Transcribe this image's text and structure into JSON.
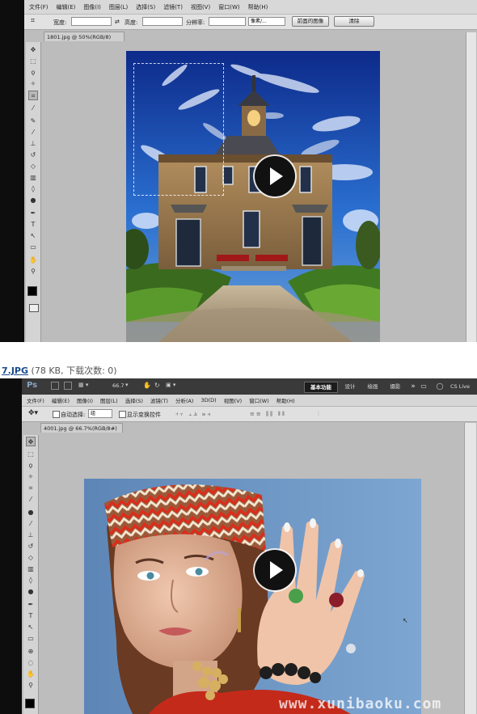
{
  "shot1": {
    "menu": [
      "文件(F)",
      "编辑(E)",
      "图像(I)",
      "图层(L)",
      "选择(S)",
      "滤镜(T)",
      "视图(V)",
      "窗口(W)",
      "帮助(H)"
    ],
    "options": {
      "width_label": "宽度:",
      "height_label": "高度:",
      "resolution_label": "分辨率:",
      "unit_value": "像素/...",
      "front_image_button": "前面的图像",
      "clear_button": "清除"
    },
    "doc_tab": "1801.jpg @ 50%(RGB/8)"
  },
  "caption": {
    "link": "7.JPG",
    "info": " (78 KB, 下载次数: 0)"
  },
  "shot2": {
    "app_logo": "Ps",
    "zoom": "66.7",
    "workspaces": [
      "基本功能",
      "设计",
      "绘画",
      "摄影"
    ],
    "more": "»",
    "cs_live": "CS Live",
    "menu": [
      "文件(F)",
      "编辑(E)",
      "图像(I)",
      "图层(L)",
      "选择(S)",
      "滤镜(T)",
      "分析(A)",
      "3D(D)",
      "视图(V)",
      "窗口(W)",
      "帮助(H)"
    ],
    "options": {
      "auto_select_label": "自动选择:",
      "auto_select_value": "组",
      "show_transform_label": "显示变换控件"
    },
    "doc_tab": "4001.jpg @ 66.7%(RGB/8#)"
  },
  "watermark": "www.xunibaoku.com",
  "colors": {
    "accent_link": "#1a4a8c",
    "dark_sidebar": "#0d0d0d",
    "canvas_gray": "#bdbdbd"
  },
  "icons": [
    "play-icon",
    "move-tool-icon",
    "marquee-tool-icon",
    "lasso-tool-icon",
    "crop-tool-icon",
    "brush-tool-icon",
    "type-tool-icon",
    "zoom-tool-icon",
    "hand-tool-icon"
  ]
}
